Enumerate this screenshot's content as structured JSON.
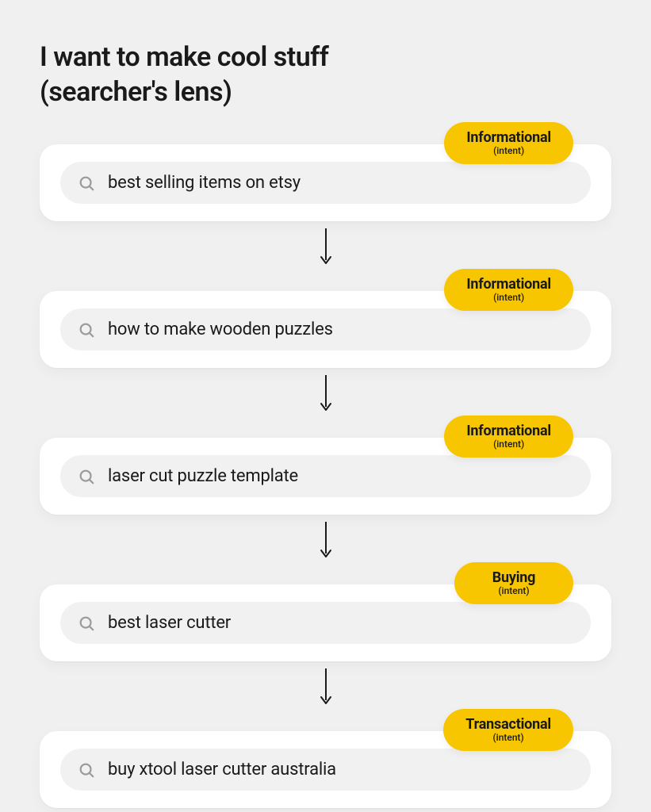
{
  "title_line1": "I want to make cool stuff",
  "title_line2": "(searcher's lens)",
  "badge_sub": "(intent)",
  "steps": [
    {
      "query": "best selling items on etsy",
      "intent": "Informational"
    },
    {
      "query": "how to make wooden puzzles",
      "intent": "Informational"
    },
    {
      "query": "laser cut puzzle template",
      "intent": "Informational"
    },
    {
      "query": "best laser cutter",
      "intent": "Buying"
    },
    {
      "query": "buy xtool laser cutter australia",
      "intent": "Transactional"
    }
  ]
}
